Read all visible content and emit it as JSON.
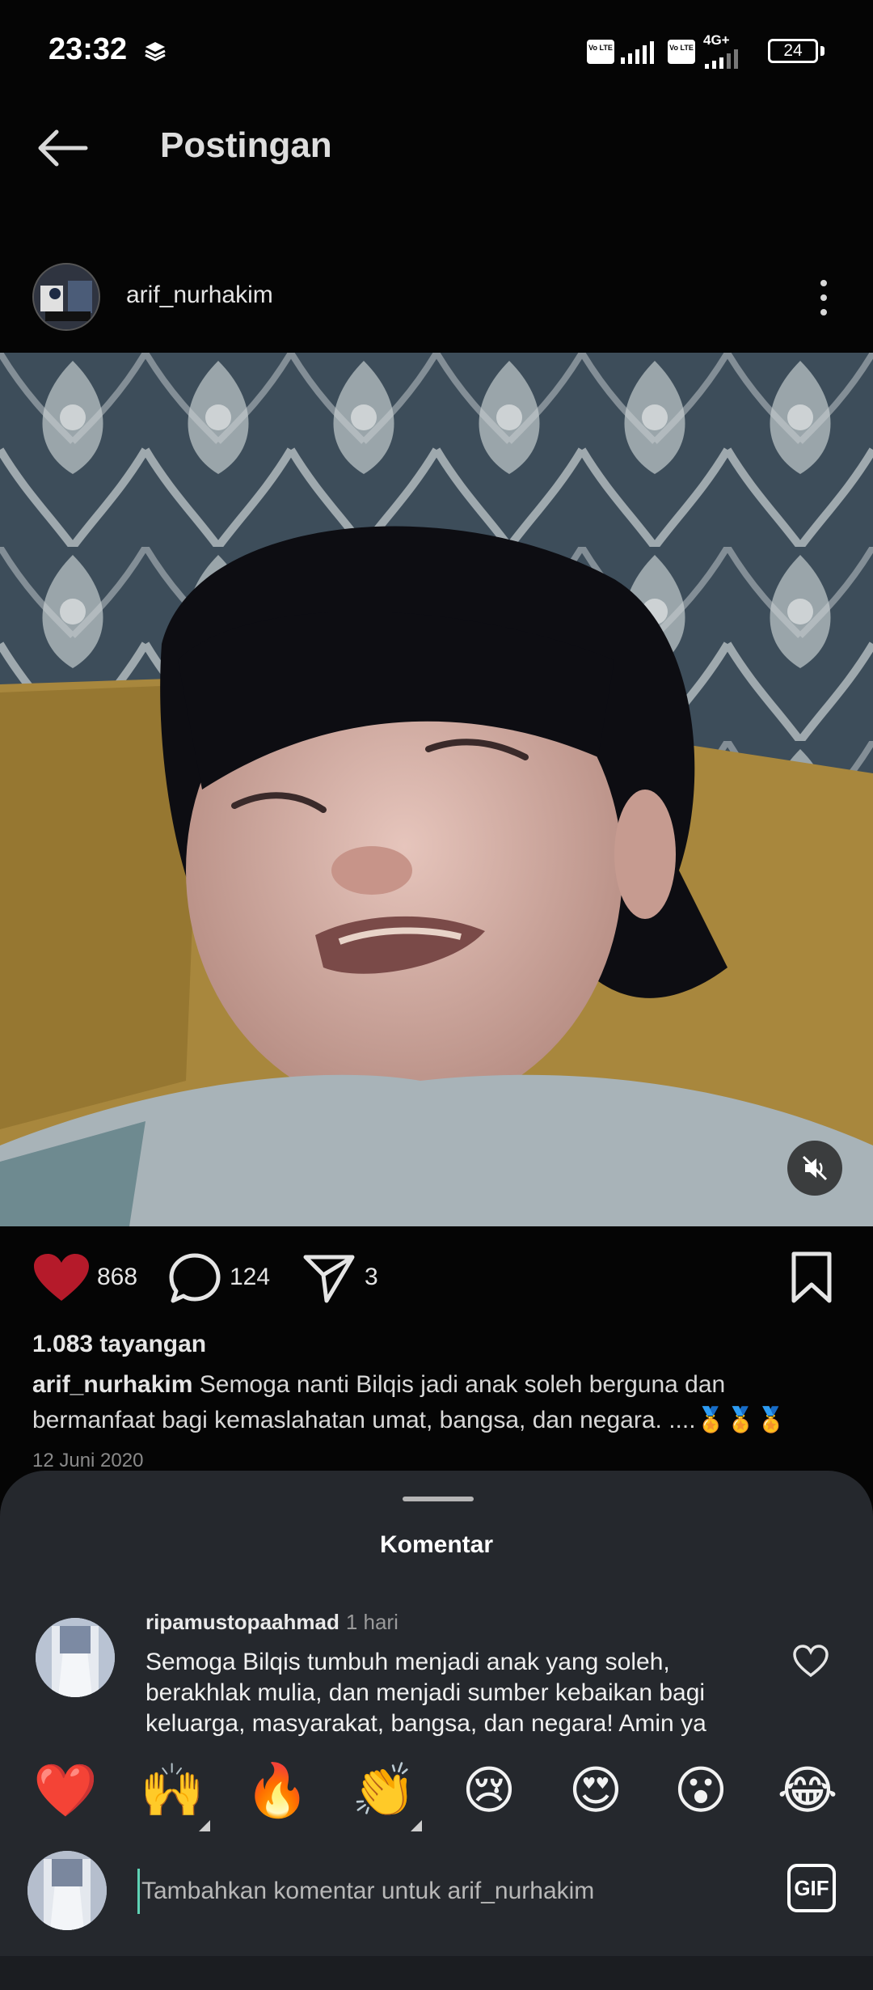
{
  "status_bar": {
    "time": "23:32",
    "network_label": "4G+",
    "battery": "24",
    "volte_label": "Vo LTE"
  },
  "header": {
    "title": "Postingan",
    "back_icon": "arrow-left-icon"
  },
  "post": {
    "author": "arif_nurhakim",
    "more_icon": "more-vertical-icon",
    "likes": "868",
    "comments": "124",
    "shares": "3",
    "views": "1.083 tayangan",
    "caption_user": "arif_nurhakim",
    "caption_text": "Semoga nanti Bilqis jadi anak soleh berguna dan bermanfaat bagi kemaslahatan umat, bangsa, dan negara. ....🏅🏅🏅",
    "date": "12 Juni 2020",
    "accent_like_color": "#c2182b"
  },
  "comments_sheet": {
    "title": "Komentar",
    "comment": {
      "username": "ripamustopaahmad",
      "time": "1 hari",
      "text": "Semoga Bilqis tumbuh menjadi anak yang soleh, berakhlak mulia, dan menjadi sumber kebaikan bagi keluarga, masyarakat, bangsa, dan negara! Amin ya"
    },
    "emojis": [
      "❤️",
      "🙌",
      "🔥",
      "👏",
      "😢",
      "😍",
      "😮",
      "😂"
    ],
    "input_placeholder": "Tambahkan komentar untuk arif_nurhakim",
    "gif_label": "GIF"
  }
}
